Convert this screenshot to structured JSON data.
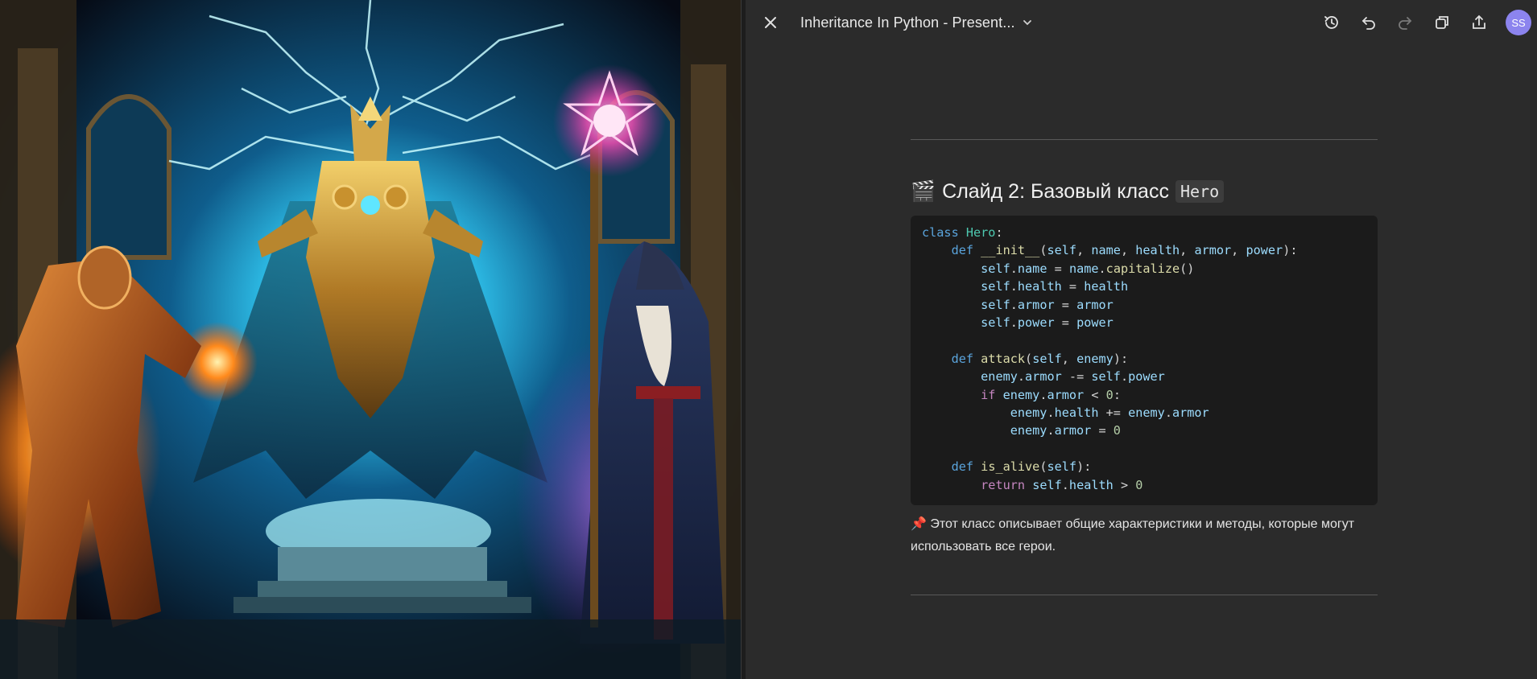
{
  "artwork": {
    "description": "fantasy illustration: golden lightning titan, fire knight, robed wizard with glowing star staff"
  },
  "toolbar": {
    "title": "Inheritance In Python - Present...",
    "avatar_initials": "SS",
    "icons": [
      "close-icon",
      "chevron-down-icon",
      "history-icon",
      "undo-icon",
      "redo-icon",
      "duplicate-icon",
      "share-icon"
    ]
  },
  "slide": {
    "emoji": "🎬",
    "heading": "Слайд 2: Базовый класс",
    "heading_code": "Hero",
    "code_lines": [
      "class Hero:",
      "    def __init__(self, name, health, armor, power):",
      "        self.name = name.capitalize()",
      "        self.health = health",
      "        self.armor = armor",
      "        self.power = power",
      "",
      "    def attack(self, enemy):",
      "        enemy.armor -= self.power",
      "        if enemy.armor < 0:",
      "            enemy.health += enemy.armor",
      "            enemy.armor = 0",
      "",
      "    def is_alive(self):",
      "        return self.health > 0"
    ],
    "note_pin": "📌",
    "note_text": "Этот класс описывает общие характеристики и методы, которые могут использовать все герои."
  },
  "colors": {
    "background": "#2b2b2b",
    "code_background": "#1b1b1b",
    "avatar": "#8c84ee",
    "keyword": "#5aa4dc",
    "class_name": "#4ec9b0",
    "function": "#dcdcaa",
    "variable": "#9cdcfe",
    "number": "#b5cea8"
  }
}
